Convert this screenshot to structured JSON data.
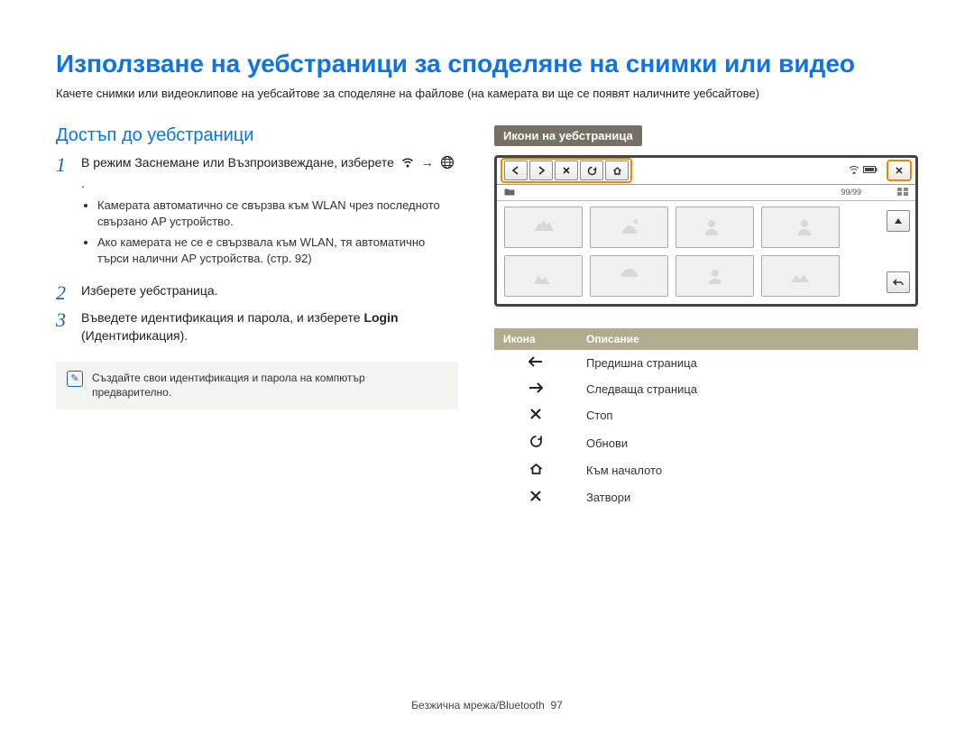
{
  "title": "Използване на уебстраници за споделяне на снимки или видео",
  "intro": "Качете снимки или видеоклипове на уебсайтове за споделяне на файлове (на камерата ви ще се появят наличните уебсайтове)",
  "left": {
    "section_heading": "Достъп до уебстраници",
    "steps": [
      {
        "num": "1",
        "pre": "В режим Заснемане или Възпроизвеждане, изберете",
        "post": ".",
        "bullets": [
          "Камерата автоматично се свързва към WLAN чрез последното свързано AP устройство.",
          "Ако камерата не се е свързвала към WLAN, тя автоматично търси налични AP устройства. (стр. 92)"
        ]
      },
      {
        "num": "2",
        "text": "Изберете уебстраница."
      },
      {
        "num": "3",
        "pre": "Въведете идентификация и парола, и изберете ",
        "strong": "Login",
        "post": " (Идентификация)."
      }
    ]
  },
  "note": "Създайте свои идентификация и парола на компютър предварително.",
  "right": {
    "badge": "Икони на уебстраница",
    "counter": "99/99"
  },
  "table": {
    "head_icon": "Икона",
    "head_desc": "Описание",
    "rows": [
      {
        "icon": "back-arrow-icon",
        "desc": "Предишна страница"
      },
      {
        "icon": "forward-arrow-icon",
        "desc": "Следваща страница"
      },
      {
        "icon": "stop-icon",
        "desc": "Стоп"
      },
      {
        "icon": "refresh-icon",
        "desc": "Обнови"
      },
      {
        "icon": "home-icon",
        "desc": "Към началото"
      },
      {
        "icon": "close-icon",
        "desc": "Затвори"
      }
    ]
  },
  "footer": {
    "section": "Безжична мрежа/Bluetooth",
    "page": "97"
  }
}
